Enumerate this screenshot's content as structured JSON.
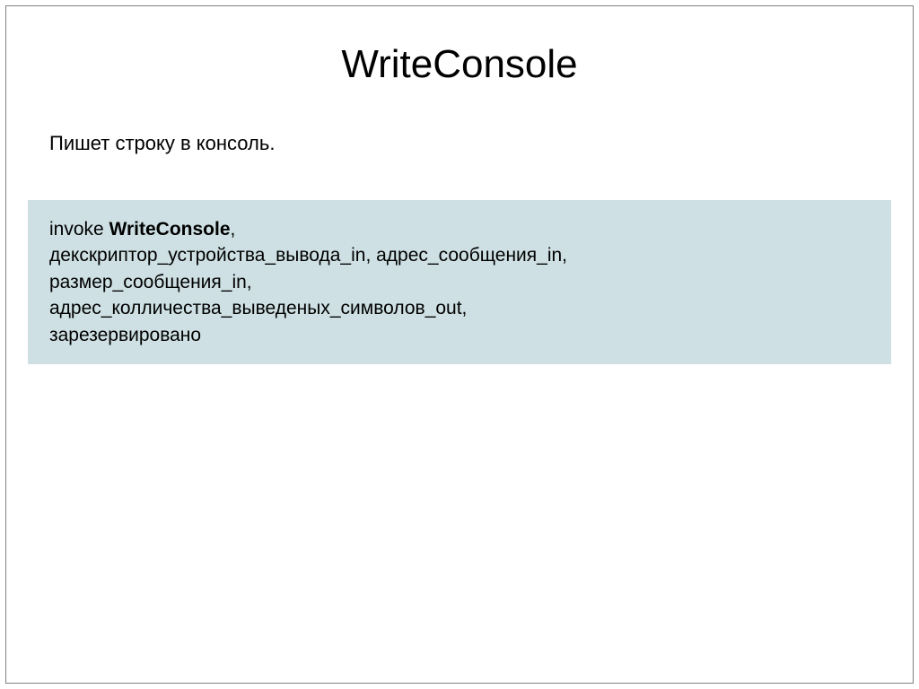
{
  "slide": {
    "title": "WriteConsole",
    "description": "Пишет строку в консоль.",
    "code": {
      "keyword": "invoke",
      "funcname": "WriteConsole",
      "line1_suffix": ",",
      "line2": "декскриптор_устройства_вывода_in, адрес_сообщения_in,",
      "line3": "размер_сообщения_in,",
      "line4": "адрес_колличества_выведеных_символов_out,",
      "line5": "зарезервировано"
    }
  }
}
